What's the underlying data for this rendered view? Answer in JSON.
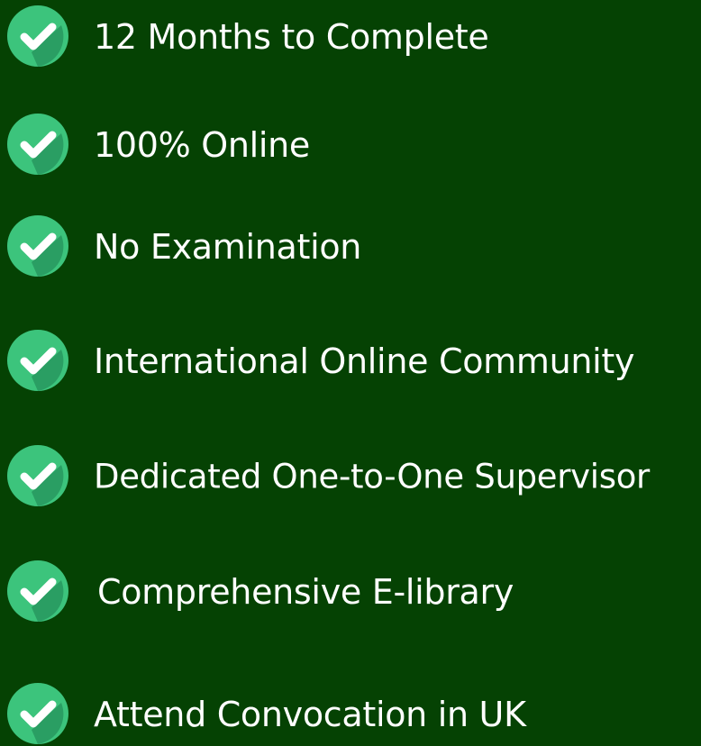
{
  "features": [
    {
      "label": "12 Months to Complete",
      "icon": "check-circle-icon"
    },
    {
      "label": "100% Online",
      "icon": "check-circle-icon"
    },
    {
      "label": "No Examination",
      "icon": "check-circle-icon"
    },
    {
      "label": "International Online Community",
      "icon": "check-circle-icon"
    },
    {
      "label": "Dedicated One-to-One Supervisor",
      "icon": "check-circle-icon"
    },
    {
      "label": "Comprehensive E-library",
      "icon": "check-circle-icon"
    },
    {
      "label": "Attend Convocation in UK",
      "icon": "check-circle-icon"
    }
  ],
  "colors": {
    "background": "#054203",
    "icon_circle": "#3cc47c",
    "icon_shadow": "#2a9e63",
    "text": "#ffffff"
  }
}
